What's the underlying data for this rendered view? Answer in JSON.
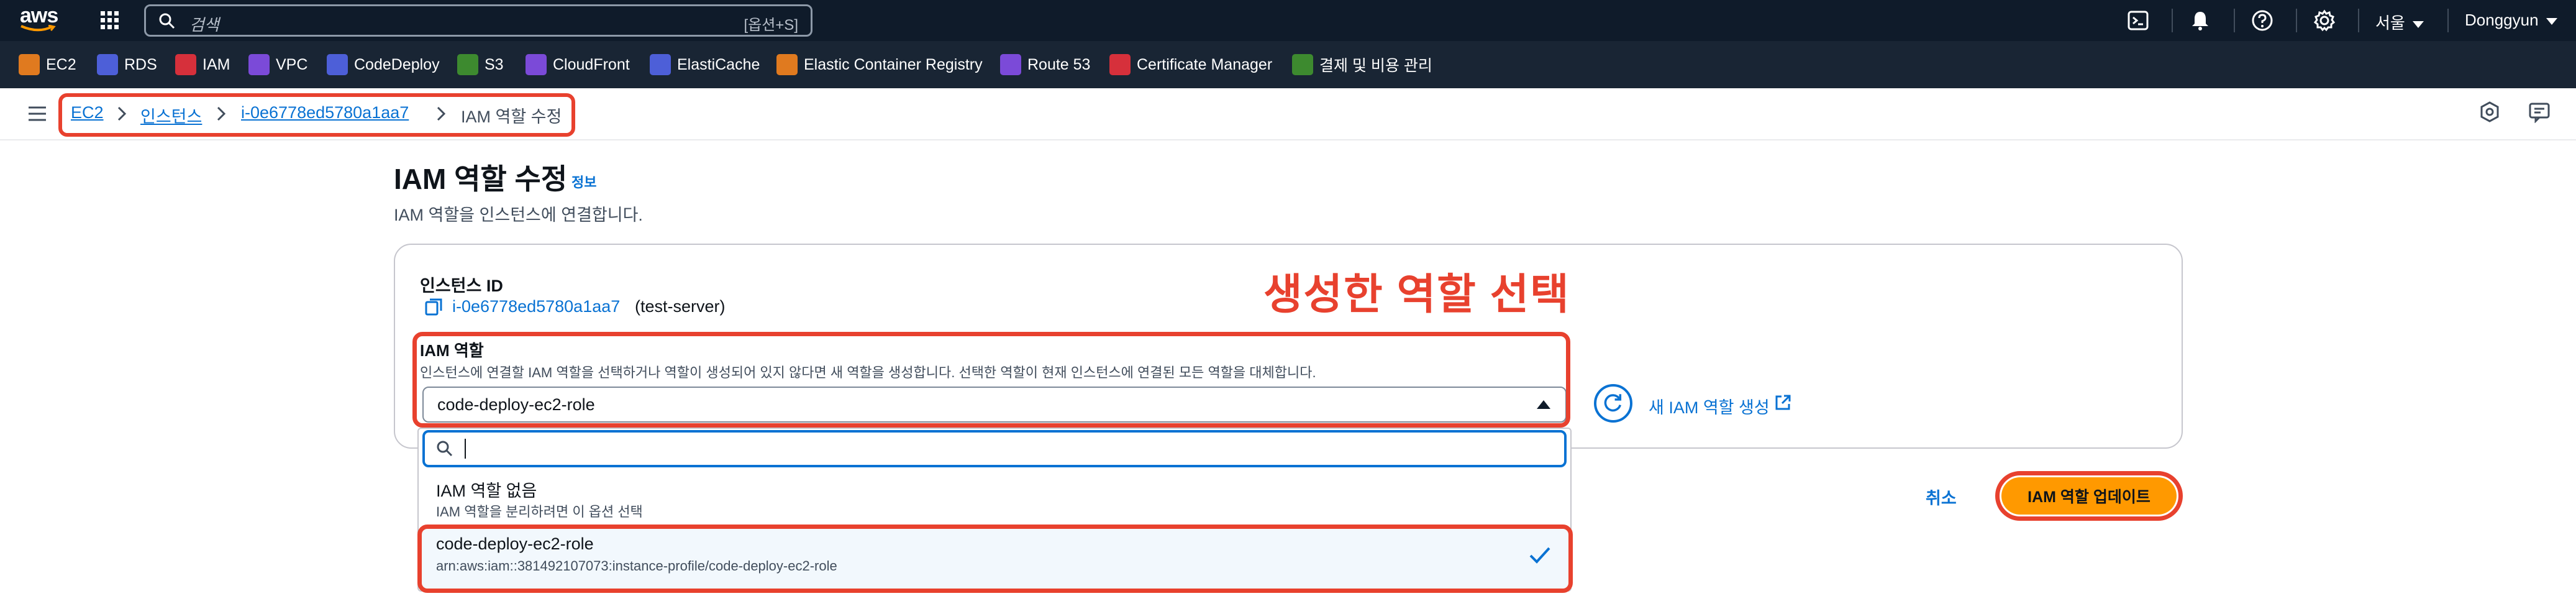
{
  "topnav": {
    "logo_text": "aws",
    "search_placeholder": "검색",
    "search_shortcut": "[옵션+S]",
    "region": "서울",
    "user": "Donggyun"
  },
  "favorites": [
    {
      "label": "EC2",
      "icon": "ec2-icon",
      "color": "#e07a1f"
    },
    {
      "label": "RDS",
      "icon": "rds-icon",
      "color": "#4d5fd8"
    },
    {
      "label": "IAM",
      "icon": "iam-icon",
      "color": "#d6303b"
    },
    {
      "label": "VPC",
      "icon": "vpc-icon",
      "color": "#7b4ad8"
    },
    {
      "label": "CodeDeploy",
      "icon": "codedeploy-icon",
      "color": "#4d5fd8"
    },
    {
      "label": "S3",
      "icon": "s3-icon",
      "color": "#3d8a2f"
    },
    {
      "label": "CloudFront",
      "icon": "cloudfront-icon",
      "color": "#7b4ad8"
    },
    {
      "label": "ElastiCache",
      "icon": "elasticache-icon",
      "color": "#4d5fd8"
    },
    {
      "label": "Elastic Container Registry",
      "icon": "ecr-icon",
      "color": "#e07a1f"
    },
    {
      "label": "Route 53",
      "icon": "route53-icon",
      "color": "#7b4ad8"
    },
    {
      "label": "Certificate Manager",
      "icon": "acm-icon",
      "color": "#d6303b"
    },
    {
      "label": "결제 및 비용 관리",
      "icon": "billing-icon",
      "color": "#3d8a2f"
    }
  ],
  "breadcrumb": {
    "items": [
      "EC2",
      "인스턴스",
      "i-0e6778ed5780a1aa7"
    ],
    "current": "IAM 역할 수정"
  },
  "page": {
    "title": "IAM 역할 수정",
    "info": "정보",
    "subtitle": "IAM 역할을 인스턴스에 연결합니다."
  },
  "instance": {
    "label": "인스턴스 ID",
    "id": "i-0e6778ed5780a1aa7",
    "name": "(test-server)"
  },
  "annotation": "생성한 역할 선택",
  "iam_role": {
    "label": "IAM 역할",
    "description": "인스턴스에 연결할 IAM 역할을 선택하거나 역할이 생성되어 있지 않다면 새 역할을 생성합니다. 선택한 역할이 현재 인스턴스에 연결된 모든 역할을 대체합니다.",
    "selected": "code-deploy-ec2-role",
    "create_link": "새 IAM 역할 생성"
  },
  "dropdown": {
    "search_value": "",
    "options": [
      {
        "title": "IAM 역할 없음",
        "desc": "IAM 역할을 분리하려면 이 옵션 선택"
      },
      {
        "title": "code-deploy-ec2-role",
        "desc": "arn:aws:iam::381492107073:instance-profile/code-deploy-ec2-role"
      }
    ]
  },
  "actions": {
    "cancel": "취소",
    "submit": "IAM 역할 업데이트"
  },
  "colors": {
    "nav_bg": "#0f1b2a",
    "fav_bg": "#192534",
    "link": "#0972d3",
    "primary": "#ff9900",
    "annotation": "#e8412e"
  }
}
